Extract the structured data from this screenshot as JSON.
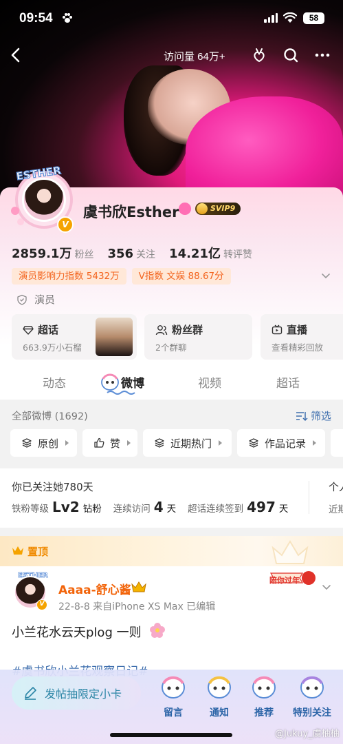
{
  "status": {
    "time": "09:54",
    "battery": "58"
  },
  "nav": {
    "visits": "访问量 64万+"
  },
  "profile": {
    "avatar_text": "ESTHER",
    "name": "虞书欣Esther",
    "svip": "SVIP9",
    "stats": [
      {
        "value": "2859.1万",
        "label": "粉丝"
      },
      {
        "value": "356",
        "label": "关注"
      },
      {
        "value": "14.21亿",
        "label": "转评赞"
      }
    ],
    "tags": [
      "演员影响力指数 5432万",
      "V指数 文娱 88.67分"
    ],
    "role": "演员"
  },
  "tiles": [
    {
      "title": "超话",
      "sub": "663.9万小石榴",
      "icon": "diamond-icon"
    },
    {
      "title": "粉丝群",
      "sub": "2个群聊",
      "icon": "users-icon"
    },
    {
      "title": "直播",
      "sub": "查看精彩回放",
      "icon": "tv-icon"
    }
  ],
  "tabs": [
    "动态",
    "微博",
    "视频",
    "超话"
  ],
  "feed": {
    "all_posts": "全部微博 (1692)",
    "filter": "筛选",
    "chips": [
      "原创",
      "赞",
      "近期热门",
      "作品记录"
    ]
  },
  "follow": {
    "line1": "你已关注她780天",
    "level_label": "铁粉等级",
    "level_value": "Lv2",
    "level_suffix": "钻粉",
    "visit_label": "连续访问",
    "visit_value": "4",
    "visit_unit": "天",
    "sign_label": "超话连续签到",
    "sign_value": "497",
    "sign_unit": "天",
    "more1": "个人",
    "more2": "近期"
  },
  "post": {
    "pinned": "置顶",
    "ribbon": "陪你过年",
    "author": "Aaaa-舒心酱",
    "meta": "22-8-8  来自iPhone XS Max  已编辑",
    "text": "小兰花水云天plog 一则",
    "hashtag": "#虞书欣小兰花观察日记#"
  },
  "bottom": {
    "post_btn": "发帖抽限定小卡",
    "items": [
      "留言",
      "通知",
      "推荐",
      "特别关注"
    ]
  },
  "watermark": "@Jukuy_虞柚柚",
  "colors": {
    "accent_orange": "#f2640a",
    "link_blue": "#3f6fae",
    "pink": "#f0209a"
  }
}
